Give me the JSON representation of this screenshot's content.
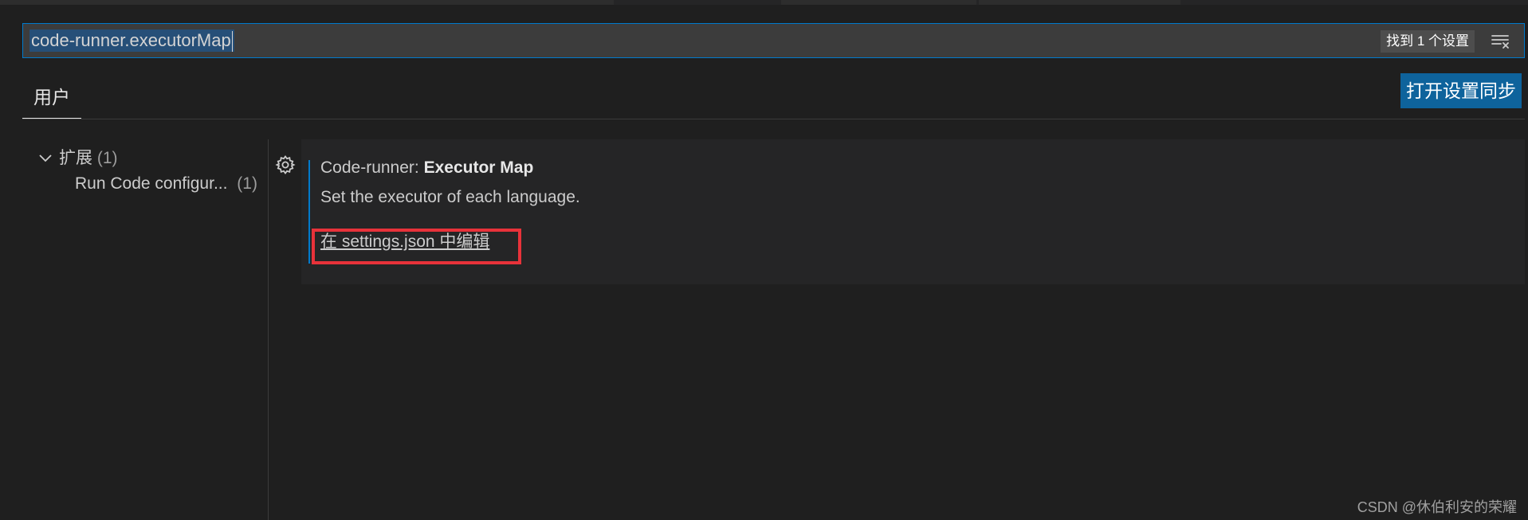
{
  "search": {
    "value": "code-runner.executorMap",
    "result_count": "找到 1 个设置",
    "clear_icon": "clear-filter-icon"
  },
  "tabs": {
    "user_label": "用户",
    "sync_button_label": "打开设置同步"
  },
  "toc": {
    "group": {
      "label": "扩展",
      "count": "(1)",
      "icon": "chevron-down-icon"
    },
    "item": {
      "label": "Run Code configur...",
      "count": "(1)"
    }
  },
  "setting": {
    "category_prefix": "Code-runner: ",
    "title": "Executor Map",
    "description": "Set the executor of each language.",
    "edit_link_label": "在 settings.json 中编辑",
    "gear_icon": "gear-icon"
  },
  "watermark": "CSDN @休伯利安的荣耀",
  "colors": {
    "accent_blue": "#007acc",
    "button_blue": "#0e639c",
    "annotation_red": "#e8323a",
    "background": "#1f1f1f"
  }
}
